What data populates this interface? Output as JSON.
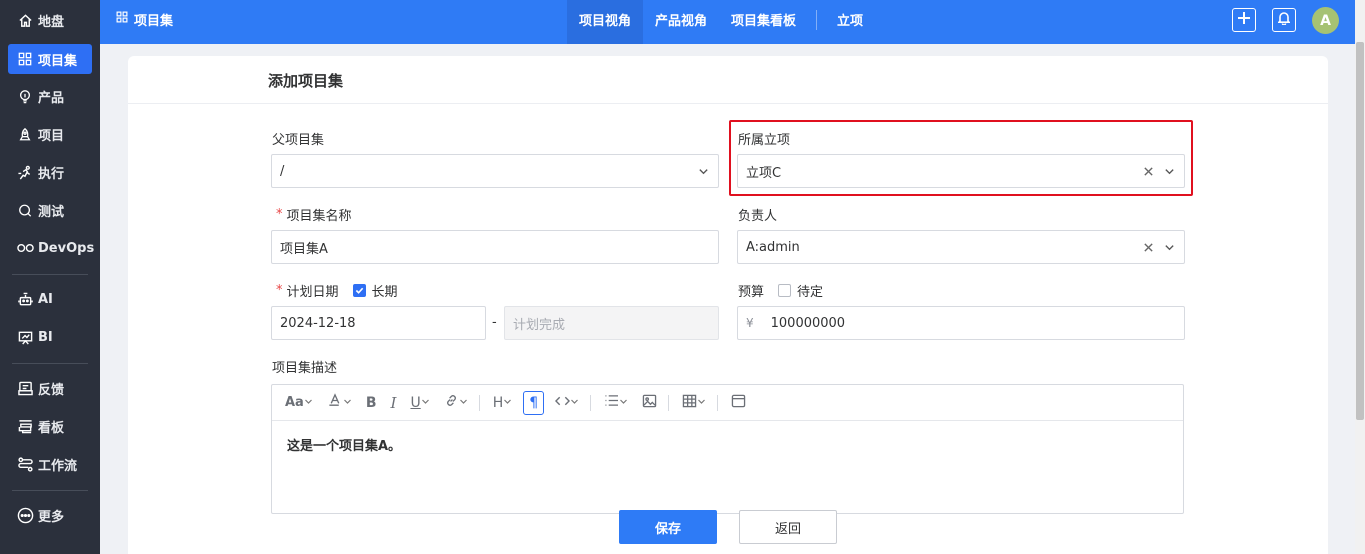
{
  "sidebar": {
    "items": [
      {
        "label": "地盘",
        "icon": "home-icon"
      },
      {
        "label": "项目集",
        "icon": "grid-icon"
      },
      {
        "label": "产品",
        "icon": "lightbulb-icon"
      },
      {
        "label": "项目",
        "icon": "rocket-icon"
      },
      {
        "label": "执行",
        "icon": "run-icon"
      },
      {
        "label": "测试",
        "icon": "magnifier-icon"
      },
      {
        "label": "DevOps",
        "icon": "infinity-icon"
      },
      {
        "label": "AI",
        "icon": "robot-icon"
      },
      {
        "label": "BI",
        "icon": "chart-board-icon"
      },
      {
        "label": "反馈",
        "icon": "feedback-icon"
      },
      {
        "label": "看板",
        "icon": "kanban-icon"
      },
      {
        "label": "工作流",
        "icon": "workflow-icon"
      },
      {
        "label": "更多",
        "icon": "more-icon"
      }
    ]
  },
  "topbar": {
    "breadcrumb": "项目集",
    "tabs": [
      "项目视角",
      "产品视角",
      "项目集看板",
      "立项"
    ],
    "avatar": "A"
  },
  "form": {
    "title": "添加项目集",
    "parent": {
      "label": "父项目集",
      "value": "/"
    },
    "initiation": {
      "label": "所属立项",
      "value": "立项C"
    },
    "name": {
      "label": "项目集名称",
      "value": "项目集A"
    },
    "owner": {
      "label": "负责人",
      "value": "A:admin"
    },
    "plan": {
      "label": "计划日期",
      "longterm_label": "长期",
      "longterm_checked": true,
      "begin": "2024-12-18",
      "dash": "-",
      "end_placeholder": "计划完成"
    },
    "budget": {
      "label": "预算",
      "pending_label": "待定",
      "pending_checked": false,
      "currency": "¥",
      "value": "100000000"
    },
    "desc": {
      "label": "项目集描述",
      "content": "这是一个项目集A。"
    },
    "save_label": "保存",
    "back_label": "返回"
  },
  "colors": {
    "primary": "#2e7bf6",
    "sidebar": "#2b303c",
    "highlight": "#e0101f"
  }
}
